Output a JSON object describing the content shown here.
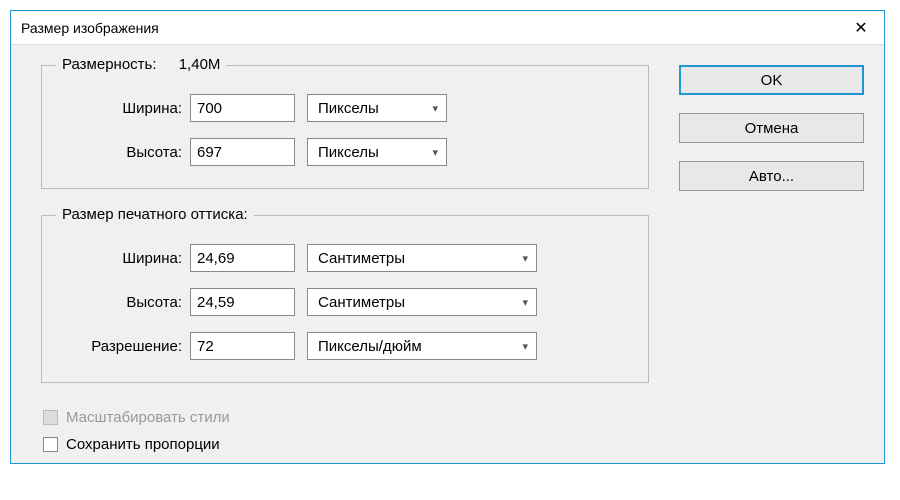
{
  "title": "Размер изображения",
  "dimensions_group": {
    "legend_label": "Размерность:",
    "legend_value": "1,40M",
    "width_label": "Ширина:",
    "width_value": "700",
    "width_unit": "Пикселы",
    "height_label": "Высота:",
    "height_value": "697",
    "height_unit": "Пикселы"
  },
  "print_group": {
    "legend": "Размер печатного оттиска:",
    "width_label": "Ширина:",
    "width_value": "24,69",
    "width_unit": "Сантиметры",
    "height_label": "Высота:",
    "height_value": "24,59",
    "height_unit": "Сантиметры",
    "resolution_label": "Разрешение:",
    "resolution_value": "72",
    "resolution_unit": "Пикселы/дюйм"
  },
  "checkboxes": {
    "scale_styles": "Масштабировать стили",
    "constrain": "Сохранить пропорции"
  },
  "buttons": {
    "ok": "OK",
    "cancel": "Отмена",
    "auto": "Авто..."
  }
}
